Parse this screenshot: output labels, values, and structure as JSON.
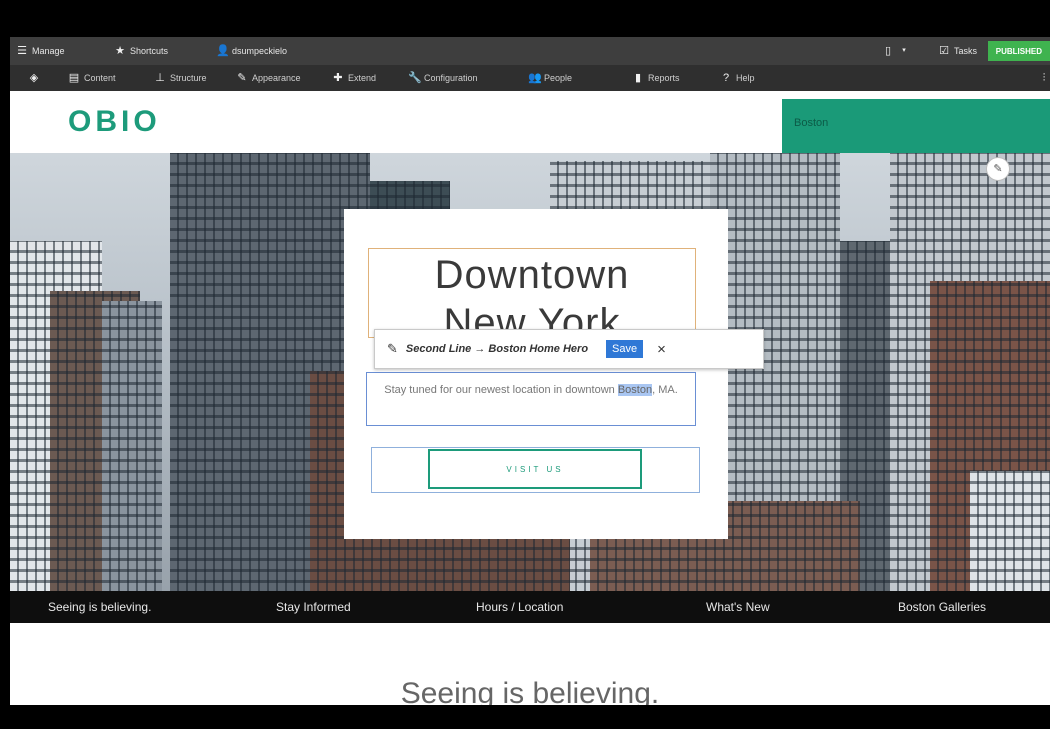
{
  "toolbar": {
    "manage": "Manage",
    "shortcuts": "Shortcuts",
    "user": "dsumpeckielo",
    "tasks": "Tasks",
    "publish": "PUBLISHED"
  },
  "admin_menu": [
    {
      "label": "Content",
      "icon": "content-icon"
    },
    {
      "label": "Structure",
      "icon": "structure-icon"
    },
    {
      "label": "Appearance",
      "icon": "appearance-icon"
    },
    {
      "label": "Extend",
      "icon": "extend-icon"
    },
    {
      "label": "Configuration",
      "icon": "configuration-icon"
    },
    {
      "label": "People",
      "icon": "people-icon"
    },
    {
      "label": "Reports",
      "icon": "reports-icon"
    },
    {
      "label": "Help",
      "icon": "help-icon"
    }
  ],
  "site": {
    "logo": "OBIO",
    "location": "Boston"
  },
  "hero": {
    "title_line1": "Downtown",
    "title_line2": "New York",
    "paragraph_before": "Stay tuned for our newest location in downtown ",
    "paragraph_highlight": "Boston",
    "paragraph_after": ", MA.",
    "button": "VISIT US"
  },
  "tooltip": {
    "label": "Second Line → Boston Home Hero",
    "save": "Save",
    "close": "×"
  },
  "nav": [
    "Seeing is believing.",
    "Stay Informed",
    "Hours / Location",
    "What's New",
    "Boston Galleries"
  ],
  "section_title": "Seeing is believing."
}
